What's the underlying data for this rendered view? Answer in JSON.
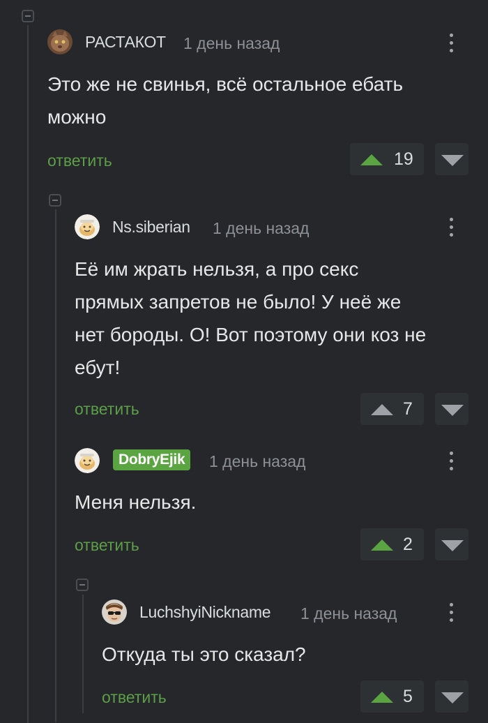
{
  "reply_label": "ответить",
  "colors": {
    "accent_green": "#5aa541",
    "background": "#25272a"
  },
  "comments": [
    {
      "author": "РАСТАКОТ",
      "time": "1 день назад",
      "avatar": "cat-avatar",
      "lines": [
        "Это же не свинья, всё остальное ебать",
        "можно"
      ],
      "rating": "19",
      "upvoted": true
    },
    {
      "author": "Ns.siberian",
      "time": "1 день назад",
      "avatar": "default-avatar",
      "lines": [
        "Её им жрать нельзя, а про секс",
        "прямых запретов не было! У неё же",
        "нет бороды. О! Вот поэтому они коз не",
        "ебут!"
      ],
      "rating": "7",
      "upvoted": false
    },
    {
      "author": "DobryEjik",
      "time": "1 день назад",
      "avatar": "default-avatar",
      "lines": [
        "Меня нельзя."
      ],
      "rating": "2",
      "upvoted": true,
      "author_badge": true
    },
    {
      "author": "LuchshyiNickname",
      "time": "1 день назад",
      "avatar": "man-sunglasses-avatar",
      "lines": [
        "Откуда ты это сказал?"
      ],
      "rating": "5",
      "upvoted": true
    }
  ]
}
